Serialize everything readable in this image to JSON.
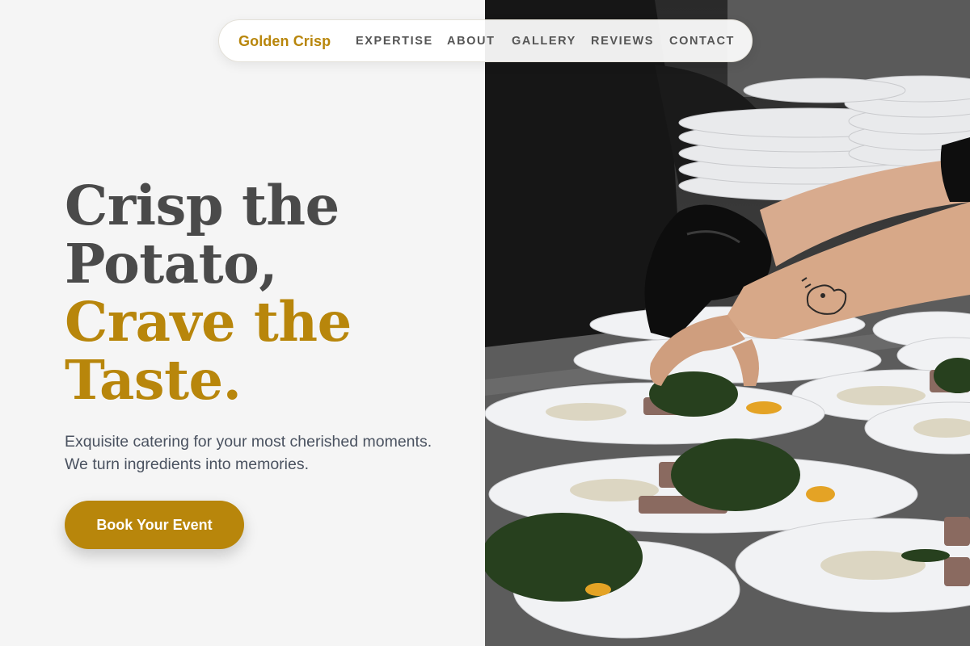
{
  "nav": {
    "brand": "Golden Crisp",
    "links": [
      "EXPERTISE",
      "ABOUT",
      "GALLERY",
      "REVIEWS",
      "CONTACT"
    ]
  },
  "hero": {
    "headline_dark": [
      "Crisp the",
      "Potato,"
    ],
    "headline_gold": [
      "Crave the",
      "Taste."
    ],
    "subtitle": "Exquisite catering for your most cherished moments. We turn ingredients into memories.",
    "cta_label": "Book Your Event"
  },
  "colors": {
    "accent": "#b8860b",
    "heading": "#4a4a4a",
    "body_text": "#4a5260",
    "background": "#f5f5f5"
  }
}
